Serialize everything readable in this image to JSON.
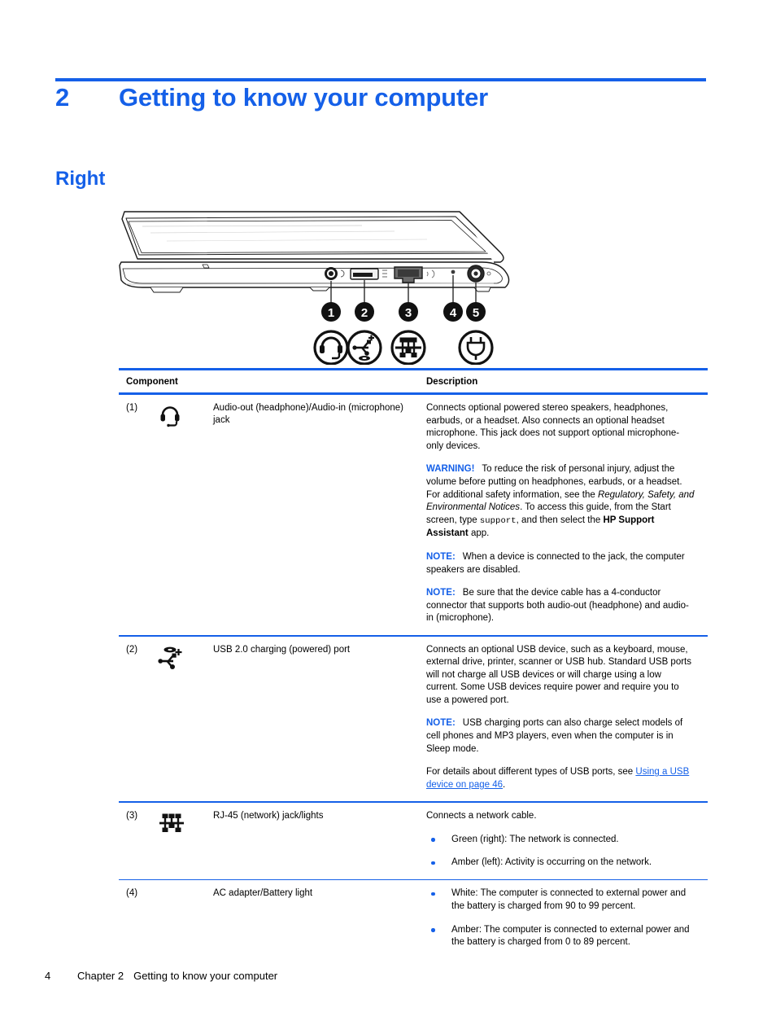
{
  "chapter": {
    "number": "2",
    "title": "Getting to know your computer"
  },
  "section": {
    "heading": "Right"
  },
  "illustration": {
    "alt": "Right side view of laptop computer with five numbered callouts",
    "callouts": [
      "1",
      "2",
      "3",
      "4",
      "5"
    ],
    "icons": [
      "headset-icon",
      "usb-charging-icon",
      "rj45-network-icon",
      "",
      "ac-power-icon"
    ]
  },
  "table": {
    "header": {
      "component": "Component",
      "description": "Description"
    },
    "rows": [
      {
        "num": "(1)",
        "icon": "headset-icon",
        "label": "Audio-out (headphone)/Audio-in (microphone) jack",
        "desc_intro": "Connects optional powered stereo speakers, headphones, earbuds, or a headset. Also connects an optional headset microphone. This jack does not support optional microphone-only devices.",
        "warning_keyword": "WARNING!",
        "warning_part1": "To reduce the risk of personal injury, adjust the volume before putting on headphones, earbuds, or a headset. For additional safety information, see the ",
        "warning_italic": "Regulatory, Safety, and Environmental Notices",
        "warning_part2": ". To access this guide, from the Start screen, type ",
        "warning_mono": "support",
        "warning_part3": ", and then select the ",
        "warning_bold": "HP Support Assistant",
        "warning_part4": " app.",
        "note1_keyword": "NOTE:",
        "note1_text": "When a device is connected to the jack, the computer speakers are disabled.",
        "note2_keyword": "NOTE:",
        "note2_text": "Be sure that the device cable has a 4-conductor connector that supports both audio-out (headphone) and audio-in (microphone)."
      },
      {
        "num": "(2)",
        "icon": "usb-charging-icon",
        "label": "USB 2.0 charging (powered) port",
        "desc_intro": "Connects an optional USB device, such as a keyboard, mouse, external drive, printer, scanner or USB hub. Standard USB ports will not charge all USB devices or will charge using a low current. Some USB devices require power and require you to use a powered port.",
        "note1_keyword": "NOTE:",
        "note1_text": "USB charging ports can also charge select models of cell phones and MP3 players, even when the computer is in Sleep mode.",
        "xref_intro": "For details about different types of USB ports, see ",
        "xref_link": "Using a USB device on page 46",
        "xref_end": "."
      },
      {
        "num": "(3)",
        "icon": "rj45-network-icon",
        "label": "RJ-45 (network) jack/lights",
        "desc_intro": "Connects a network cable.",
        "bullets": [
          "Green (right): The network is connected.",
          "Amber (left): Activity is occurring on the network."
        ]
      },
      {
        "num": "(4)",
        "icon": "",
        "label": "AC adapter/Battery light",
        "bullets": [
          "White: The computer is connected to external power and the battery is charged from 90 to 99 percent.",
          "Amber: The computer is connected to external power and the battery is charged from 0 to 89 percent."
        ]
      }
    ]
  },
  "footer": {
    "page_number": "4",
    "chapter_label": "Chapter 2",
    "chapter_title": "Getting to know your computer"
  },
  "colors": {
    "accent_blue": "#1560e8",
    "text_black": "#000000",
    "page_background": "#ffffff"
  }
}
